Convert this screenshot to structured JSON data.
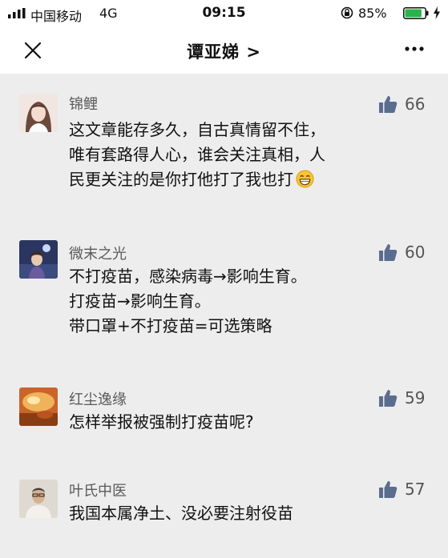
{
  "status_bar": {
    "carrier": "中国移动",
    "network": "4G",
    "time": "09:15",
    "battery_percent": "85%",
    "battery_level": 0.85
  },
  "header": {
    "title": "谭亚娣 >",
    "close_icon": "close-icon",
    "more_icon": "more-icon"
  },
  "comments": [
    {
      "username": "锦鲤",
      "likes": "66",
      "lines": [
        "这文章能存多久，自古真情留不住，",
        "唯有套路得人心，谁会关注真相，人",
        "民更关注的是你打他打了我也打"
      ],
      "emoji": "grin-emoji"
    },
    {
      "username": "微末之光",
      "likes": "60",
      "lines": [
        "不打疫苗，感染病毒→影响生育。",
        "打疫苗→影响生育。",
        "带口罩+不打疫苗=可选策略"
      ]
    },
    {
      "username": "红尘逸缘",
      "likes": "59",
      "lines": [
        "怎样举报被强制打疫苗呢?"
      ]
    },
    {
      "username": "叶氏中医",
      "likes": "57",
      "lines": [
        "我国本属净土、没必要注射役苗"
      ]
    }
  ],
  "colors": {
    "background": "#ededed",
    "like_icon": "#5b6d8f",
    "battery_fill": "#2bb34b"
  }
}
